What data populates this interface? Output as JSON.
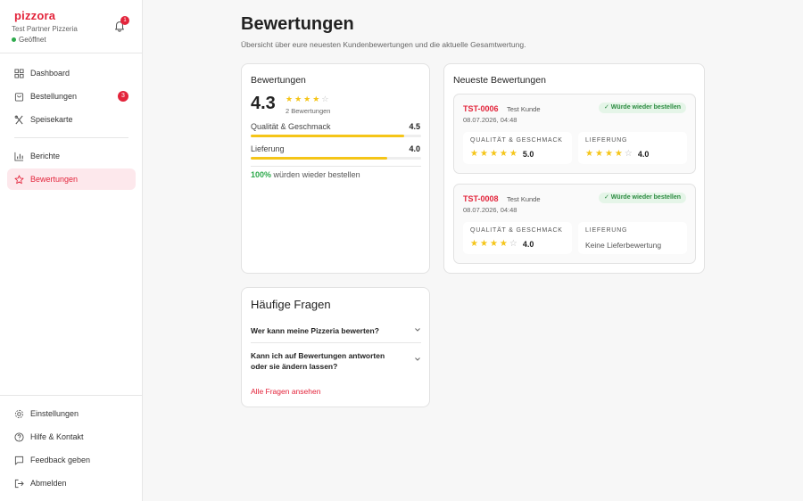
{
  "brand": {
    "logo": "pizzora",
    "partner": "Test Partner Pizzeria",
    "status": "Geöffnet",
    "notifications": "1"
  },
  "nav": {
    "items": [
      {
        "label": "Dashboard",
        "icon": "dashboard-icon"
      },
      {
        "label": "Bestellungen",
        "icon": "shopping-bag-icon",
        "badge": "3"
      },
      {
        "label": "Speisekarte",
        "icon": "utensils-icon"
      },
      {
        "label": "Berichte",
        "icon": "bar-chart-icon"
      },
      {
        "label": "Bewertungen",
        "icon": "star-icon",
        "active": true
      }
    ],
    "bottom": [
      {
        "label": "Einstellungen",
        "icon": "gear-icon"
      },
      {
        "label": "Hilfe & Kontakt",
        "icon": "help-icon"
      },
      {
        "label": "Feedback geben",
        "icon": "message-icon"
      },
      {
        "label": "Abmelden",
        "icon": "logout-icon"
      }
    ]
  },
  "page": {
    "title": "Bewertungen",
    "subtitle": "Übersicht über eure neuesten Kundenbewertungen und die aktuelle Gesamtwertung."
  },
  "summary": {
    "heading": "Bewertungen",
    "score": "4.3",
    "score_stars": 4,
    "count": "2 Bewertungen",
    "metrics": [
      {
        "label": "Qualität & Geschmack",
        "value": "4.5",
        "fraction": 0.9
      },
      {
        "label": "Lieferung",
        "value": "4.0",
        "fraction": 0.8
      }
    ],
    "recommend_pct": "100%",
    "recommend_text": "würden wieder bestellen"
  },
  "faq": {
    "title": "Häufige Fragen",
    "questions": [
      "Wer kann meine Pizzeria bewerten?",
      "Kann ich auf Bewertungen antworten oder sie ändern lassen?"
    ],
    "link": "Alle Fragen ansehen"
  },
  "recent": {
    "heading": "Neueste Bewertungen",
    "reviews": [
      {
        "id": "TST-0006",
        "customer": "Test Kunde",
        "date": "08.07.2026, 04:48",
        "badge": "✓ Würde wieder bestellen",
        "quality_label": "QUALITÄT & GESCHMACK",
        "quality_value": "5.0",
        "quality_stars": 5,
        "delivery_label": "LIEFERUNG",
        "delivery_value": "4.0",
        "delivery_stars": 4
      },
      {
        "id": "TST-0008",
        "customer": "Test Kunde",
        "date": "08.07.2026, 04:48",
        "badge": "✓ Würde wieder bestellen",
        "quality_label": "QUALITÄT & GESCHMACK",
        "quality_value": "4.0",
        "quality_stars": 4,
        "delivery_label": "LIEFERUNG",
        "delivery_text": "Keine Lieferbewertung"
      }
    ]
  },
  "colors": {
    "accent": "#e3243b",
    "star": "#f5c518",
    "success": "#2eaa4c"
  }
}
